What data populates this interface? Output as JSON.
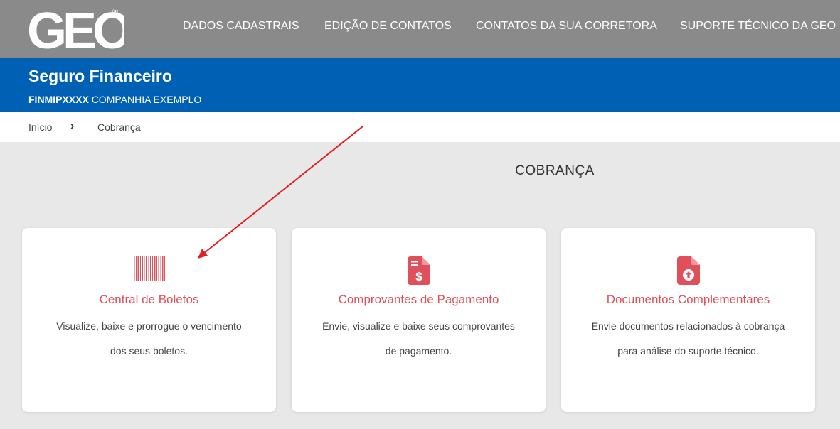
{
  "header": {
    "logo_text": "GEO",
    "logo_mark": "®",
    "nav": [
      {
        "label": "DADOS CADASTRAIS"
      },
      {
        "label": "EDIÇÃO DE CONTATOS"
      },
      {
        "label": "CONTATOS DA SUA CORRETORA"
      },
      {
        "label": "SUPORTE TÉCNICO DA GEO"
      }
    ]
  },
  "banner": {
    "title": "Seguro Financeiro",
    "policy_code": "FINMIPXXXX",
    "company": "COMPANHIA EXEMPLO"
  },
  "breadcrumb": {
    "home": "Início",
    "current": "Cobrança"
  },
  "page": {
    "title": "COBRANÇA"
  },
  "cards": [
    {
      "icon": "barcode-icon",
      "title": "Central de Boletos",
      "description": "Visualize, baixe e prorrogue o vencimento dos seus boletos."
    },
    {
      "icon": "payment-receipt-icon",
      "title": "Comprovantes de Pagamento",
      "description": "Envie, visualize e baixe seus comprovantes de pagamento."
    },
    {
      "icon": "file-upload-icon",
      "title": "Documentos Complementares",
      "description": "Envie documentos relacionados à cobrança para análise do suporte técnico."
    }
  ],
  "colors": {
    "header_bg": "#8a8a8a",
    "banner_bg": "#0061b4",
    "accent": "#e0505a",
    "page_bg": "#e8e8e8",
    "annotation_arrow": "#e02020"
  }
}
